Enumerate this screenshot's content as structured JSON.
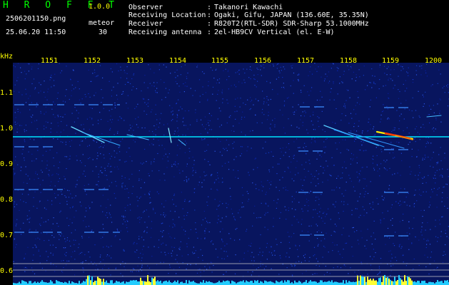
{
  "header": {
    "app_title": "H R O F F T",
    "version": "1.0.0",
    "filename": "2506201150.png",
    "datetime": "25.06.20 11:50",
    "meteor_label": "meteor",
    "meteor_count": "30"
  },
  "info": [
    {
      "label": "Observer",
      "value": "Takanori Kawachi"
    },
    {
      "label": "Receiving Location",
      "value": "Ogaki, Gifu, JAPAN (136.60E, 35.35N)"
    },
    {
      "label": "Receiver",
      "value": "R820T2(RTL-SDR) SDR-Sharp 53.1000MHz"
    },
    {
      "label": "Receiving antenna",
      "value": "2el-HB9CV Vertical (el. E-W)"
    }
  ],
  "separator": ":",
  "axis": {
    "y_unit": "kHz",
    "y_ticks": [
      "1.1",
      "1.0",
      "0.9",
      "0.8",
      "0.7",
      "0.6"
    ],
    "x_ticks": [
      "1151",
      "1152",
      "1153",
      "1154",
      "1155",
      "1156",
      "1157",
      "1158",
      "1159",
      "1200"
    ]
  },
  "colors": {
    "title": "#00ff00",
    "axis_text": "#ffff00",
    "background": "#000000",
    "noise": "#0a1a8c",
    "carrier": "#00e5ff",
    "hot": "#ff3300"
  }
}
